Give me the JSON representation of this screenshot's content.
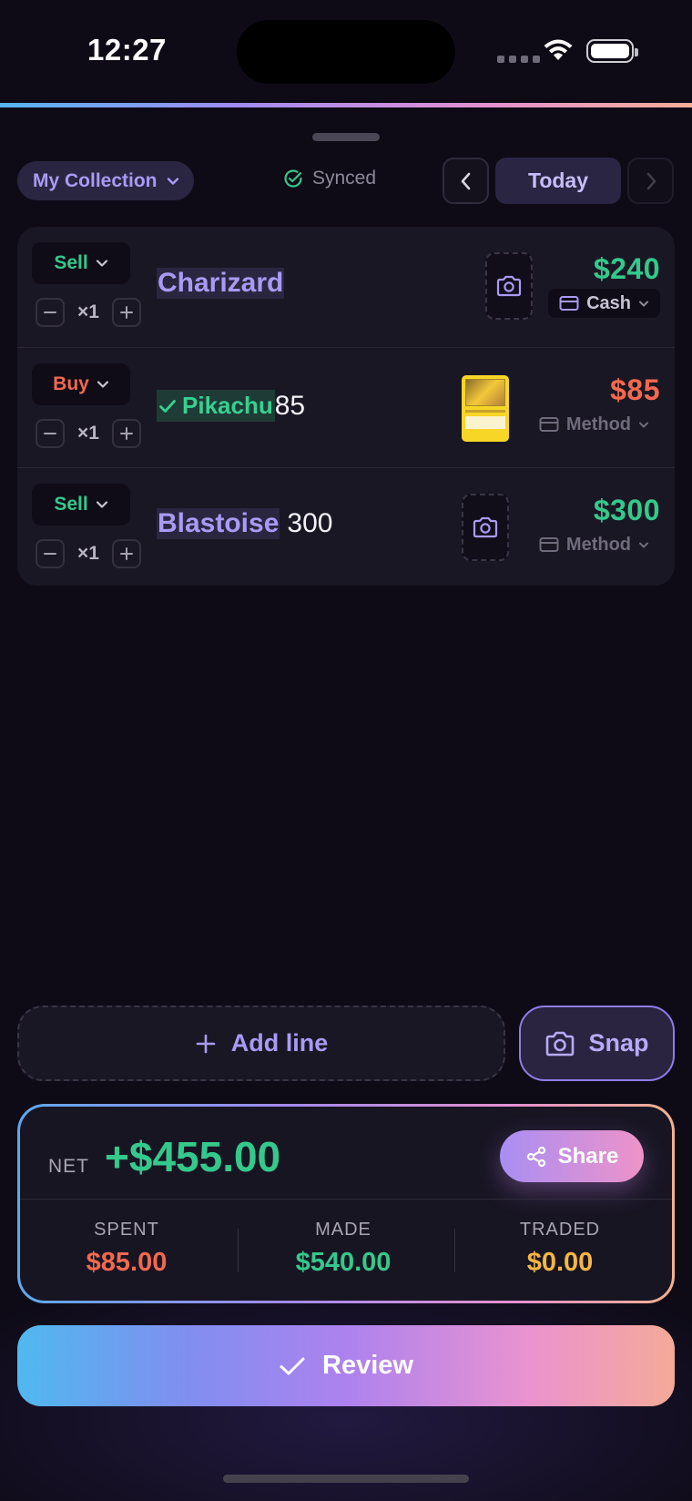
{
  "status_bar": {
    "time": "12:27"
  },
  "toolbar": {
    "collection_label": "My Collection",
    "sync_status": "Synced",
    "date_label": "Today"
  },
  "items": [
    {
      "type": "Sell",
      "quantity": "×1",
      "name": "Charizard",
      "typed_text": "",
      "price": "$240",
      "method": "Cash",
      "has_photo": false
    },
    {
      "type": "Buy",
      "quantity": "×1",
      "name": "Pikachu",
      "typed_text": "85",
      "price": "$85",
      "method": "Method",
      "has_photo": true
    },
    {
      "type": "Sell",
      "quantity": "×1",
      "name": "Blastoise",
      "typed_text": "300",
      "price": "$300",
      "method": "Method",
      "has_photo": false
    }
  ],
  "actions": {
    "add_line_label": "Add line",
    "snap_label": "Snap"
  },
  "summary": {
    "net_label": "NET",
    "net_value": "+$455.00",
    "share_label": "Share",
    "spent_label": "SPENT",
    "spent_value": "$85.00",
    "made_label": "MADE",
    "made_value": "$540.00",
    "traded_label": "TRADED",
    "traded_value": "$0.00"
  },
  "review_label": "Review",
  "colors": {
    "accent": "#a99af5",
    "positive": "#34c98c",
    "negative": "#f2694f",
    "traded": "#f4b740",
    "background": "#0e0b17"
  },
  "icons": [
    "wifi-icon",
    "battery-icon",
    "chevron-down-icon",
    "check-circle-icon",
    "chevron-left-icon",
    "chevron-right-icon",
    "minus-icon",
    "plus-icon",
    "camera-icon",
    "card-icon",
    "check-icon",
    "share-icon"
  ]
}
